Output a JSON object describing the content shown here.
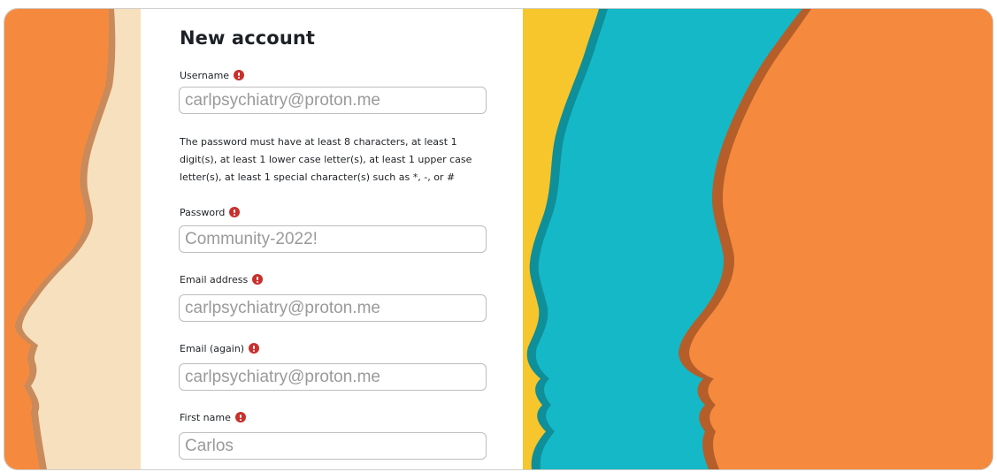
{
  "form": {
    "title": "New account",
    "password_policy": "The password must have at least 8 characters, at least 1 digit(s), at least 1 lower case letter(s), at least 1 upper case letter(s), at least 1 special character(s) such as *, -, or #",
    "fields": {
      "username": {
        "label": "Username",
        "value": "carlpsychiatry@proton.me"
      },
      "password": {
        "label": "Password",
        "value": "Community-2022!"
      },
      "email": {
        "label": "Email address",
        "value": "carlpsychiatry@proton.me"
      },
      "email_again": {
        "label": "Email (again)",
        "value": "carlpsychiatry@proton.me"
      },
      "first_name": {
        "label": "First name",
        "value": "Carlos"
      }
    },
    "required_icon": "exclamation-circle-icon"
  },
  "colors": {
    "required": "#c9302c",
    "orange": "#f58a3e",
    "cream": "#f7e0bd",
    "teal": "#15b8c6",
    "yellow": "#f7c52c"
  }
}
